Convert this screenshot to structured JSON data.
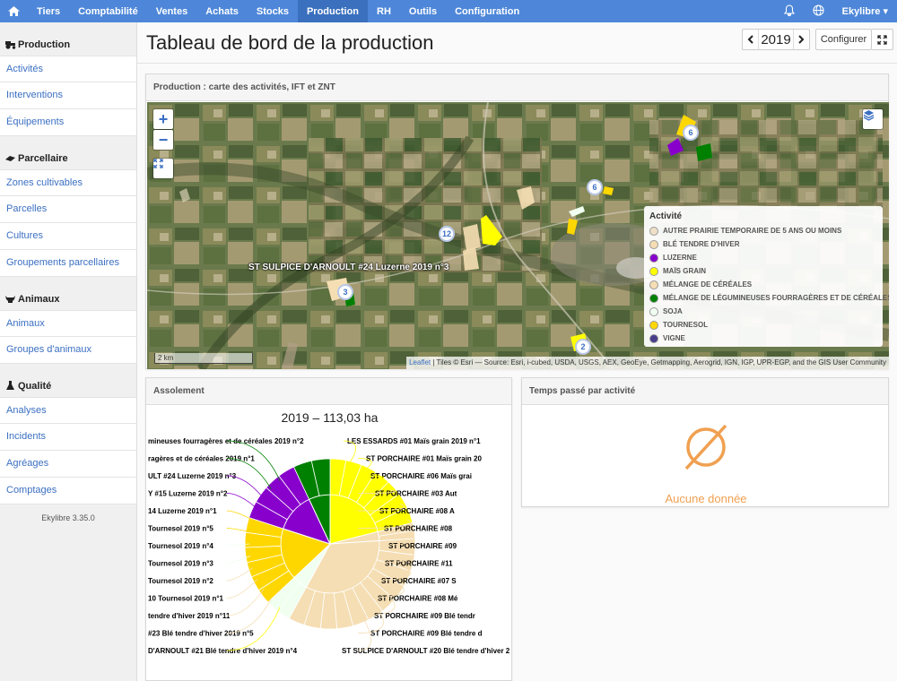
{
  "nav": {
    "items": [
      "Tiers",
      "Comptabilité",
      "Ventes",
      "Achats",
      "Stocks",
      "Production",
      "RH",
      "Outils",
      "Configuration"
    ],
    "active": "Production",
    "user": "Ekylibre ▾"
  },
  "sidebar": {
    "sections": [
      {
        "title": "Production",
        "icon": "tractor-icon",
        "items": [
          "Activités",
          "Interventions",
          "Équipements"
        ]
      },
      {
        "title": "Parcellaire",
        "icon": "field-icon",
        "items": [
          "Zones cultivables",
          "Parcelles",
          "Cultures",
          "Groupements parcellaires"
        ]
      },
      {
        "title": "Animaux",
        "icon": "cow-icon",
        "items": [
          "Animaux",
          "Groupes d'animaux"
        ]
      },
      {
        "title": "Qualité",
        "icon": "flask-icon",
        "items": [
          "Analyses",
          "Incidents",
          "Agréages",
          "Comptages"
        ]
      }
    ],
    "version": "Ekylibre 3.35.0"
  },
  "page": {
    "title": "Tableau de bord de la production",
    "year": "2019",
    "configure_label": "Configurer"
  },
  "map_panel": {
    "title": "Production : carte des activités, IFT et ZNT",
    "plot_label": "ST SULPICE D'ARNOULT #24 Luzerne 2019 n°3",
    "clusters": [
      "6",
      "6",
      "12",
      "3",
      "2"
    ],
    "legend": {
      "title": "Activité",
      "items": [
        {
          "label": "AUTRE PRAIRIE TEMPORAIRE DE 5 ANS OU MOINS",
          "color": "#efe0c8"
        },
        {
          "label": "BLÉ TENDRE D'HIVER",
          "color": "#f5deb3"
        },
        {
          "label": "LUZERNE",
          "color": "#8800cc"
        },
        {
          "label": "MAÏS GRAIN",
          "color": "#ffff00"
        },
        {
          "label": "MÉLANGE DE CÉRÉALES",
          "color": "#f5deb3"
        },
        {
          "label": "MÉLANGE DE LÉGUMINEUSES FOURRAGÈRES ET DE CÉRÉALES",
          "color": "#008000"
        },
        {
          "label": "SOJA",
          "color": "#f0fff0"
        },
        {
          "label": "TOURNESOL",
          "color": "#ffd700"
        },
        {
          "label": "VIGNE",
          "color": "#483d8b"
        }
      ]
    },
    "scale": "2 km",
    "attribution_link": "Leaflet",
    "attribution": " | Tiles © Esri — Source: Esri, i-cubed, USDA, USGS, AEX, GeoEye, Getmapping, Aerogrid, IGN, IGP, UPR-EGP, and the GIS User Community"
  },
  "assolement": {
    "title": "Assolement",
    "chart_title": "2019 – 113,03 ha"
  },
  "temps": {
    "title": "Temps passé par activité",
    "empty": "Aucune donnée"
  },
  "chart_data": {
    "type": "pie",
    "title": "2019 – 113,03 ha",
    "slices": [
      {
        "group": "MAÏS GRAIN",
        "color": "#ffff00",
        "value": 21
      },
      {
        "group": "MÉLANGE DE CÉRÉALES",
        "color": "#f5deb3",
        "value": 3
      },
      {
        "group": "BLÉ TENDRE D'HIVER",
        "color": "#f5deb3",
        "value": 34
      },
      {
        "group": "SOJA",
        "color": "#f0fff0",
        "value": 5
      },
      {
        "group": "TOURNESOL",
        "color": "#ffd700",
        "value": 17
      },
      {
        "group": "LUZERNE",
        "color": "#8800cc",
        "value": 13
      },
      {
        "group": "MÉLANGE DE LÉGUMINEUSES FOURRAGÈRES ET DE CÉRÉALES",
        "color": "#008000",
        "value": 7
      }
    ],
    "left_labels": [
      "mineuses fourragères et de céréales 2019 n°2",
      "ragères et de céréales 2019 n°1",
      "ULT #24 Luzerne 2019 n°3",
      "Y #15 Luzerne 2019 n°2",
      "14 Luzerne 2019 n°1",
      "Tournesol 2019 n°5",
      "Tournesol 2019 n°4",
      "Tournesol 2019 n°3",
      "Tournesol 2019 n°2",
      "10 Tournesol 2019 n°1",
      "tendre d'hiver 2019 n°11",
      "#23 Blé tendre d'hiver 2019 n°5",
      "D'ARNOULT #21 Blé tendre d'hiver 2019 n°4"
    ],
    "right_labels": [
      "LES ESSARDS #01 Maïs grain 2019 n°1",
      "ST PORCHAIRE #01 Maïs grain 20",
      "ST PORCHAIRE #06 Maïs grai",
      "ST PORCHAIRE #03 Aut",
      "ST PORCHAIRE #08 A",
      "ST PORCHAIRE #08",
      "ST PORCHAIRE #09",
      "ST PORCHAIRE #11",
      "ST PORCHAIRE #07 S",
      "ST PORCHAIRE #08 Mé",
      "ST PORCHAIRE #09 Blé tendr",
      "ST PORCHAIRE #09 Blé tendre d",
      "ST SULPICE D'ARNOULT #20 Blé tendre d'hiver 2"
    ]
  }
}
